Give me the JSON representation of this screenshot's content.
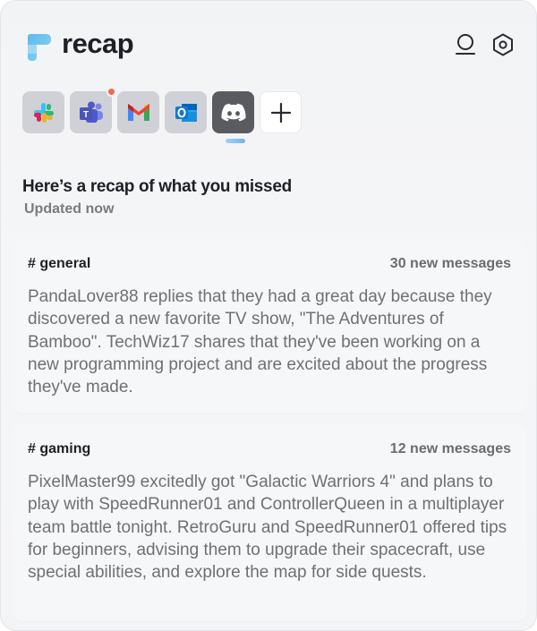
{
  "app": {
    "brand": "recap"
  },
  "apps": [
    {
      "name": "Slack",
      "icon": "slack-icon",
      "notification": false,
      "selected": false
    },
    {
      "name": "Teams",
      "icon": "teams-icon",
      "notification": true,
      "selected": false
    },
    {
      "name": "Gmail",
      "icon": "gmail-icon",
      "notification": false,
      "selected": false
    },
    {
      "name": "Outlook",
      "icon": "outlook-icon",
      "notification": false,
      "selected": false
    },
    {
      "name": "Discord",
      "icon": "discord-icon",
      "notification": false,
      "selected": true
    }
  ],
  "recap": {
    "title": "Here’s a recap of what you missed",
    "updated": "Updated now"
  },
  "channels": [
    {
      "name": "# general",
      "count": "30 new messages",
      "summary": "PandaLover88 replies that they had a great day because they discovered a new favorite TV show, \"The Adventures of Bamboo\". TechWiz17 shares that they've been working on a new programming project and are excited about the progress they've made."
    },
    {
      "name": "# gaming",
      "count": "12 new messages",
      "summary": "PixelMaster99 excitedly got \"Galactic Warriors 4\" and plans to play with SpeedRunner01 and ControllerQueen in a multiplayer team battle tonight. RetroGuru and SpeedRunner01 offered tips for beginners, advising them to upgrade their spacecraft, use special abilities, and explore the map for side quests."
    }
  ],
  "colors": {
    "accent": "#6fb5ee",
    "notification": "#ef6a4a",
    "discord": "#5865F2"
  }
}
